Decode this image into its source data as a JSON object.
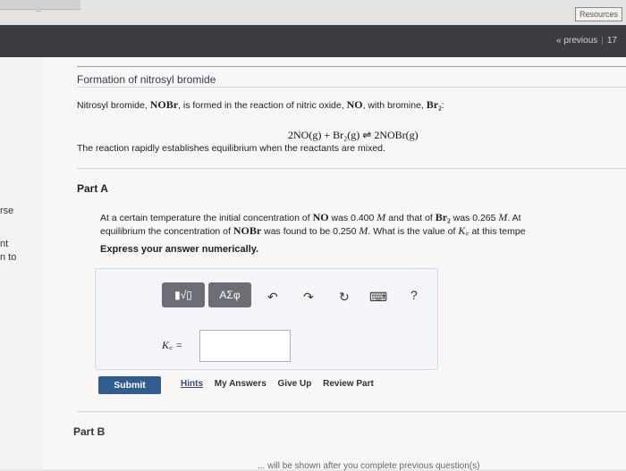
{
  "top": {
    "tab_partial": "...",
    "resources": "Resources"
  },
  "nav": {
    "previous": "« previous",
    "page": "17"
  },
  "left": {
    "items": [
      "rse",
      "nt",
      "n to"
    ]
  },
  "problem": {
    "title": "Formation of nitrosyl bromide",
    "intro_prefix": "Nitrosyl bromide,",
    "nobr": "NOBr",
    "intro_mid": ", is formed in the reaction of nitric oxide,",
    "no": "NO",
    "intro_end": ", with bromine,",
    "br2": "Br₂",
    "intro_colon": ":",
    "equation": "2NO(g) + Br₂(g) ⇌ 2NOBr(g)",
    "reaction_text": "The reaction rapidly establishes equilibrium when the reactants are mixed."
  },
  "partA": {
    "label": "Part A",
    "q1_a": "At a certain temperature the initial concentration of",
    "q1_no": "NO",
    "q1_b": "was 0.400",
    "q1_m1": "M",
    "q1_c": "and that of",
    "q1_br2": "Br₂",
    "q1_d": "was 0.265",
    "q1_m2": "M",
    "q1_e": ". At",
    "q2_a": "equilibrium the concentration of",
    "q2_nobr": "NOBr",
    "q2_b": "was found to be 0.250",
    "q2_m": "M",
    "q2_c": ". What is the value of",
    "q2_kc": "K꜀",
    "q2_d": "at this tempe",
    "express": "Express your answer numerically.",
    "toolbar": {
      "templates": "▮√▯",
      "symbols": "ΑΣφ",
      "undo": "↶",
      "redo": "↷",
      "reset": "↻",
      "keyboard": "⌨",
      "help": "?"
    },
    "kc_label": "K꜀ =",
    "kc_value": "",
    "buttons": {
      "submit": "Submit",
      "hints": "Hints",
      "my_answers": "My Answers",
      "give_up": "Give Up",
      "review_part": "Review Part"
    }
  },
  "partB": {
    "label": "Part B"
  },
  "footer": {
    "text": "... will be shown after you complete previous question(s)"
  }
}
